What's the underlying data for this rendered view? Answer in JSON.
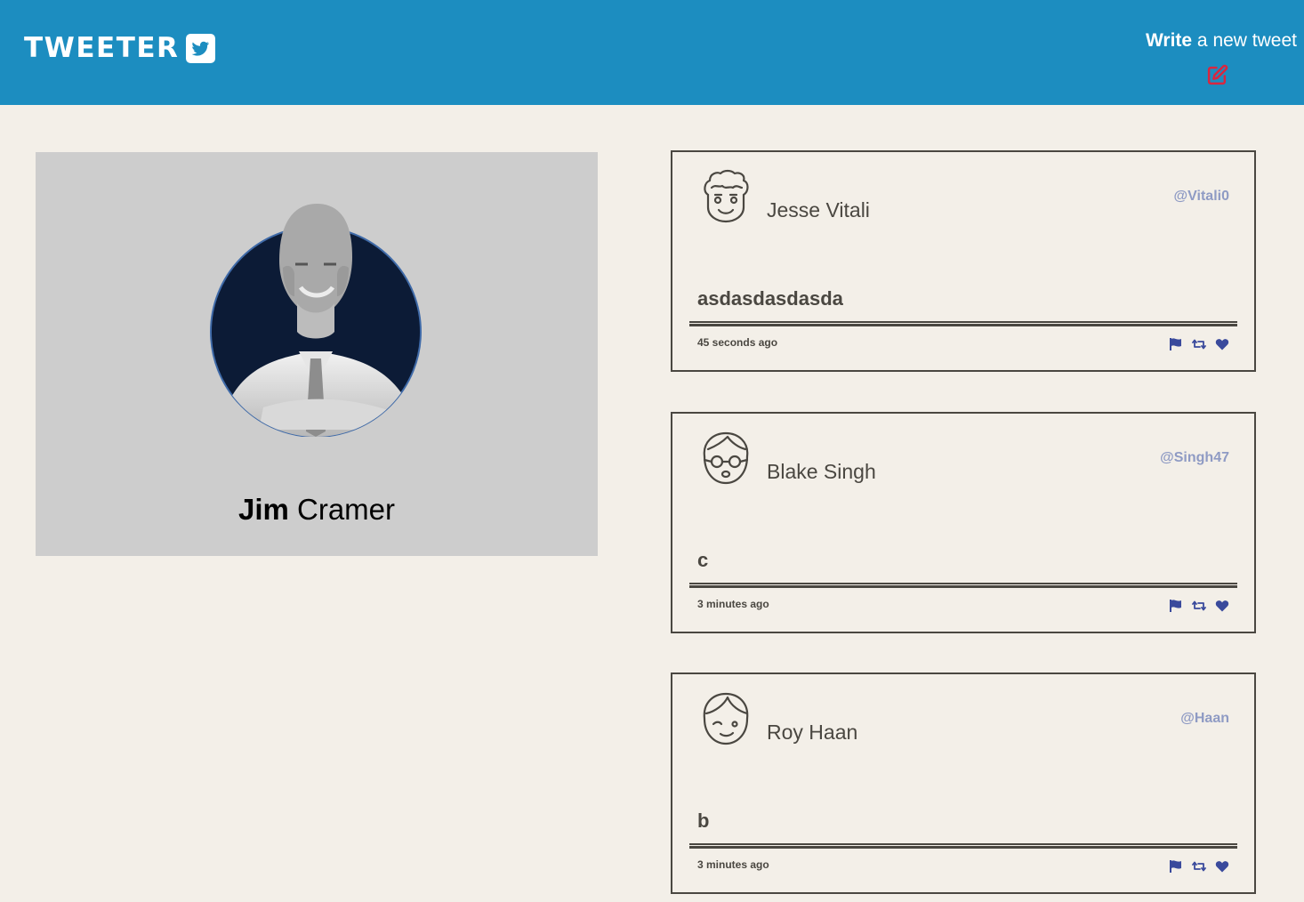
{
  "header": {
    "brand": "TWEETER",
    "brand_icon": "twitter-bird-icon",
    "compose_strong": "Write",
    "compose_rest": " a new tweet",
    "compose_icon": "edit-icon",
    "bg_color": "#1c8dc0"
  },
  "profile": {
    "first_name": "Jim",
    "last_name": " Cramer",
    "avatar": "profile-avatar-photo"
  },
  "tweets": [
    {
      "name": "Jesse Vitali",
      "handle": "@Vitali0",
      "text": "asdasdasdasda",
      "time": "45 seconds ago",
      "avatar": "curly-hair-face-icon"
    },
    {
      "name": "Blake Singh",
      "handle": "@Singh47",
      "text": "c",
      "time": "3 minutes ago",
      "avatar": "glasses-face-icon"
    },
    {
      "name": "Roy Haan",
      "handle": "@Haan",
      "text": "b",
      "time": "3 minutes ago",
      "avatar": "winking-face-icon"
    }
  ],
  "actions": [
    "flag-icon",
    "retweet-icon",
    "heart-icon"
  ],
  "colors": {
    "background": "#f3efe8",
    "text": "#4a4741",
    "handle": "#8f9bc4",
    "action": "#3a4a9c",
    "compose_icon": "#d9263f"
  }
}
